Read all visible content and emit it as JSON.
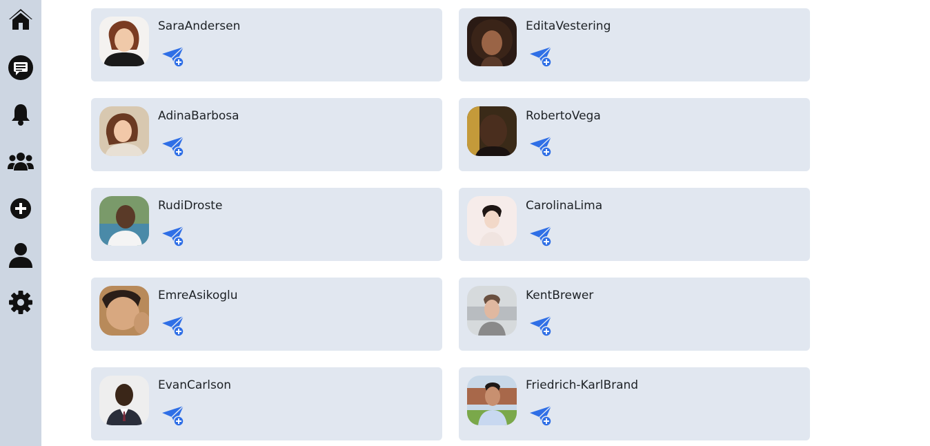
{
  "sidebar": {
    "items": [
      {
        "icon": "home-icon",
        "label": ""
      },
      {
        "icon": "messages-icon",
        "label": ""
      },
      {
        "icon": "bell-icon",
        "label": ""
      },
      {
        "icon": "users-icon",
        "label": ""
      },
      {
        "icon": "add-circle-icon",
        "label": ""
      },
      {
        "icon": "profile-icon",
        "label": ""
      },
      {
        "icon": "gear-icon",
        "label": ""
      }
    ]
  },
  "colors": {
    "sidebar_bg": "#cdd6e2",
    "card_bg": "#e1e7f0",
    "accent": "#2f6fe6",
    "icon": "#111111"
  },
  "users": [
    {
      "name": "SaraAndersen",
      "action_icon": "send-plus-icon"
    },
    {
      "name": "EditaVestering",
      "action_icon": "send-plus-icon"
    },
    {
      "name": "AdinaBarbosa",
      "action_icon": "send-plus-icon"
    },
    {
      "name": "RobertoVega",
      "action_icon": "send-plus-icon"
    },
    {
      "name": "RudiDroste",
      "action_icon": "send-plus-icon"
    },
    {
      "name": "CarolinaLima",
      "action_icon": "send-plus-icon"
    },
    {
      "name": "EmreAsikoglu",
      "action_icon": "send-plus-icon"
    },
    {
      "name": "KentBrewer",
      "action_icon": "send-plus-icon"
    },
    {
      "name": "EvanCarlson",
      "action_icon": "send-plus-icon"
    },
    {
      "name": "Friedrich-KarlBrand",
      "action_icon": "send-plus-icon"
    }
  ]
}
